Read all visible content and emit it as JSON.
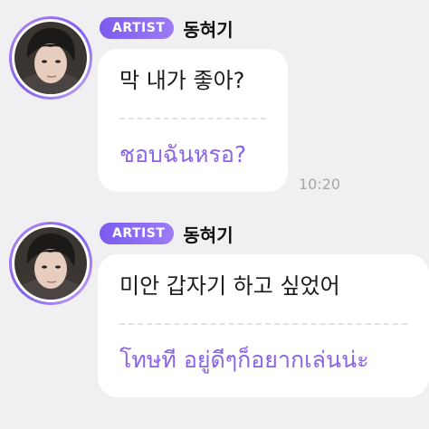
{
  "colors": {
    "background": "#f0f0f2",
    "bubble": "#ffffff",
    "badge_gradient_start": "#7b5cf0",
    "badge_gradient_end": "#9c7bf5",
    "translation_text": "#8a63e8",
    "timestamp": "#a5a5aa"
  },
  "messages": [
    {
      "avatar_icon": "artist-avatar-photo",
      "badge": "ARTIST",
      "name": "동혀기",
      "original_text": "막 내가 좋아?",
      "translation_text": "ชอบฉันหรอ?",
      "time": "10:20"
    },
    {
      "avatar_icon": "artist-avatar-photo",
      "badge": "ARTIST",
      "name": "동혀기",
      "original_text": "미안 갑자기 하고 싶었어",
      "translation_text": "โทษที อยู่ดีๆก็อยากเล่นน่ะ",
      "time": ""
    }
  ]
}
